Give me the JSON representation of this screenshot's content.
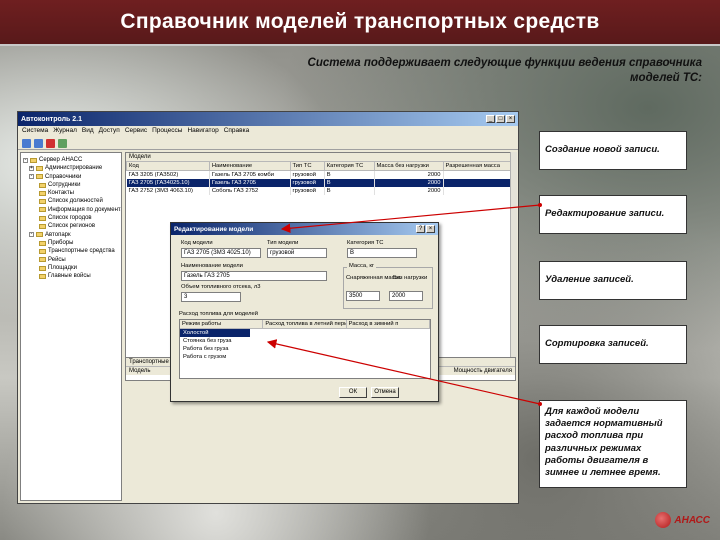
{
  "slide": {
    "title": "Справочник моделей транспортных средств",
    "intro": "Система поддерживает следующие функции ведения справочника моделей ТС:"
  },
  "callouts": [
    "Создание новой записи.",
    "Редактирование записи.",
    "Удаление записей.",
    "Сортировка записей.",
    "Для каждой модели задается нормативный расход топлива при различных режимах работы двигателя в зимнее и летнее время."
  ],
  "window": {
    "title": "Автоконтроль 2.1",
    "menu": [
      "Система",
      "Журнал",
      "Вид",
      "Доступ",
      "Сервис",
      "Процессы",
      "Навигатор",
      "Справка"
    ]
  },
  "tree": [
    {
      "label": "Сервер АНАСС",
      "level": 0
    },
    {
      "label": "Администрирование",
      "level": 1
    },
    {
      "label": "Справочники",
      "level": 1
    },
    {
      "label": "Сотрудники",
      "level": 2
    },
    {
      "label": "Контакты",
      "level": 2
    },
    {
      "label": "Список должностей",
      "level": 2
    },
    {
      "label": "Информация по документам",
      "level": 2
    },
    {
      "label": "Список городов",
      "level": 2
    },
    {
      "label": "Список регионов",
      "level": 2
    },
    {
      "label": "Автопарк",
      "level": 1
    },
    {
      "label": "Приборы",
      "level": 2
    },
    {
      "label": "Транспортные средства",
      "level": 2
    },
    {
      "label": "Рейсы",
      "level": 2
    },
    {
      "label": "Площадки",
      "level": 2
    },
    {
      "label": "Главные войсы",
      "level": 2
    }
  ],
  "grid": {
    "caption": "Модели",
    "columns": [
      "Код",
      "Наименование",
      "Тип ТС",
      "Категория ТС",
      "Масса без нагрузки",
      "Разрешенная масса"
    ],
    "rows": [
      [
        "ГАЗ 3205 (ГАЗ502)",
        "Газель ГАЗ 2705 комби",
        "грузовой",
        "В",
        "2000",
        ""
      ],
      [
        "ГАЗ 2705 (ГАЗ4025.10)",
        "Газель ГАЗ 2705",
        "грузовой",
        "В",
        "2000",
        ""
      ],
      [
        "ГАЗ 2752 (ЗМЗ 4063.10)",
        "Соболь ГАЗ 2752",
        "грузовой",
        "В",
        "2000",
        ""
      ]
    ],
    "selected_row": 1
  },
  "lower_grid": {
    "caption": "Транспортные средства",
    "col1": "Модель",
    "col2": "Мощность двигателя"
  },
  "dialog": {
    "title": "Редактирование модели",
    "code_label": "Код модели",
    "code_value": "ГАЗ 2705 (ЗМЗ 4025.10)",
    "type_label": "Тип модели",
    "type_value": "грузовой",
    "category_label": "Категория ТС",
    "category_value": "В",
    "name_label": "Наименование модели",
    "name_value": "Газель ГАЗ 2705",
    "tank_label": "Объем топливного отсека, л3",
    "tank_value": "3",
    "mass_group_label": "Масса, кг",
    "mass_loaded_label": "Снаряженная масса",
    "mass_loaded_value": "3500",
    "mass_empty_label": "Без нагрузки",
    "mass_empty_value": "2000",
    "fuel_caption": "Расход топлива для моделей",
    "fuel_columns": [
      "Режим работы",
      "Расход топлива в летний период",
      "Расход в зимний п"
    ],
    "fuel_rows": [
      "Холостой",
      "Стоянка без груза",
      "Работа без груза",
      "Работа с грузом"
    ],
    "ok_label": "ОК",
    "cancel_label": "Отмена"
  },
  "logo": {
    "text": "АНАСС"
  }
}
